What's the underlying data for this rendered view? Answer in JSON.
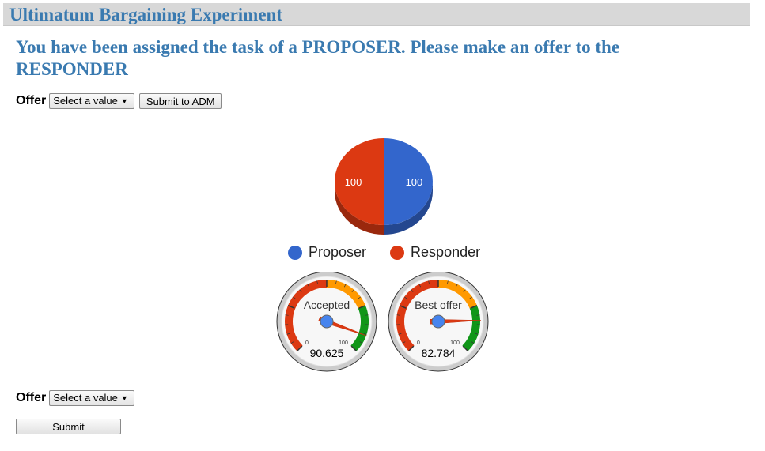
{
  "app": {
    "title": "Ultimatum Bargaining Experiment"
  },
  "instruction": "You have been assigned the task of a PROPOSER. Please make an offer to the RESPONDER",
  "top_form": {
    "offer_label": "Offer",
    "select_value": "Select a value",
    "submit_label": "Submit to ADM"
  },
  "bottom_form": {
    "offer_label": "Offer",
    "select_value": "Select a value",
    "submit_label": "Submit"
  },
  "colors": {
    "proposer": "#3366cc",
    "responder": "#dc3912",
    "title": "#3a7ab0"
  },
  "chart_data": [
    {
      "type": "pie",
      "labels": [
        "Proposer",
        "Responder"
      ],
      "values": [
        100,
        100
      ],
      "legend": "bottom"
    },
    {
      "type": "gauge",
      "label": "Accepted",
      "value": 90.625,
      "value_text": "90.625",
      "min": 0,
      "max": 100,
      "min_label": "0",
      "max_label": "100"
    },
    {
      "type": "gauge",
      "label": "Best offer",
      "value": 82.784,
      "value_text": "82.784",
      "min": 0,
      "max": 100,
      "min_label": "0",
      "max_label": "100"
    }
  ]
}
